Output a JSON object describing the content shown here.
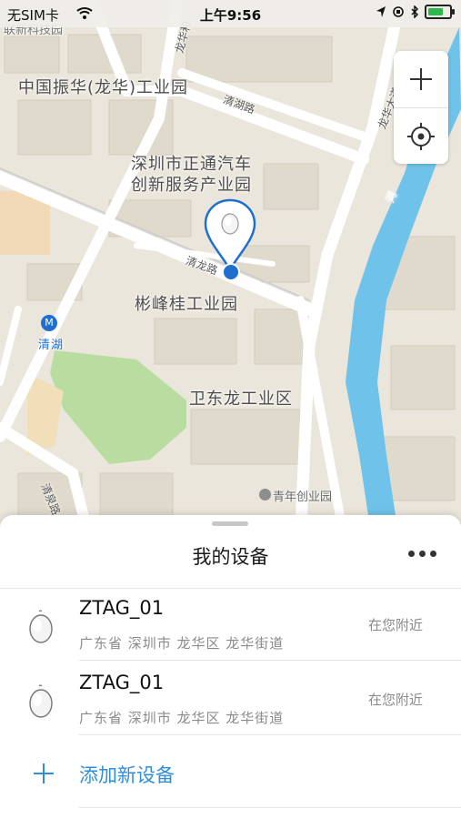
{
  "status_bar": {
    "carrier": "无SIM卡",
    "time": "上午9:56"
  },
  "map": {
    "labels": {
      "zhenhua": "中国振华(龙华)工业园",
      "qinghu_road": "清湖路",
      "zhengtong_1": "深圳市正通汽车",
      "zhengtong_2": "创新服务产业园",
      "qinglong_road": "清龙路",
      "shanfenggui": "彬峰桂工业园",
      "qinghu_station": "清湖",
      "weidonglong": "卫东龙工业区",
      "qingnian": "青年创业园",
      "longhua_ave": "龙华大道",
      "river": "河",
      "qingquan_road": "清泉路",
      "top_left": "联新科技园",
      "top_road": "龙华和"
    }
  },
  "colors": {
    "accent": "#2f8fdb",
    "pin": "#1e6fd0",
    "park": "#b9dda1",
    "water": "#6fc3ea"
  },
  "sheet": {
    "title": "我的设备",
    "devices": [
      {
        "name": "ZTAG_01",
        "location": "广东省 深圳市 龙华区 龙华街道",
        "status": "在您附近"
      },
      {
        "name": "ZTAG_01",
        "location": "广东省 深圳市 龙华区 龙华街道",
        "status": "在您附近"
      }
    ],
    "add_label": "添加新设备"
  },
  "icons": {
    "zoom": "plus-icon",
    "locate": "crosshair-icon",
    "more": "more-dots-icon",
    "device": "tag-device-icon",
    "add": "plus-icon"
  }
}
